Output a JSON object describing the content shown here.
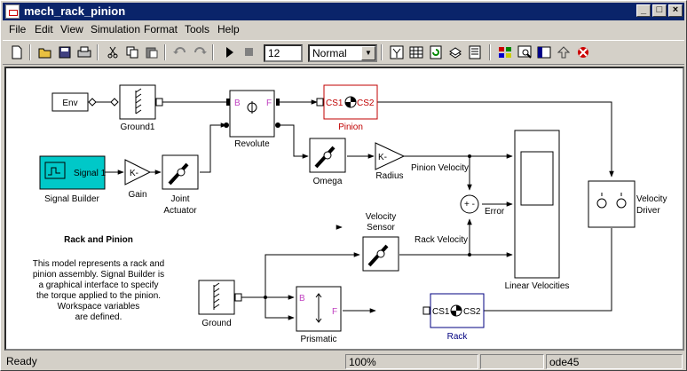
{
  "window": {
    "title": "mech_rack_pinion",
    "minimize": "_",
    "maximize": "□",
    "close": "×"
  },
  "menu": [
    "File",
    "Edit",
    "View",
    "Simulation",
    "Format",
    "Tools",
    "Help"
  ],
  "toolbar": {
    "stop_time": "12",
    "sim_mode": "Normal"
  },
  "blocks": {
    "env": "Env",
    "ground1": "Ground1",
    "revolute": "Revolute",
    "revolute_b": "B",
    "revolute_f": "F",
    "pinion": "Pinion",
    "pinion_cs1": "CS1",
    "pinion_cs2": "CS2",
    "signal_builder": "Signal Builder",
    "signal_1": "Signal 1",
    "gain": "Gain",
    "gain_k": "K-",
    "joint_actuator_1": "Joint",
    "joint_actuator_2": "Actuator",
    "omega": "Omega",
    "radius": "Radius",
    "radius_k": "K-",
    "pinion_velocity": "Pinion Velocity",
    "error": "Error",
    "sum_signs": "+ -",
    "rack_velocity": "Rack Velocity",
    "velocity_sensor_1": "Velocity",
    "velocity_sensor_2": "Sensor",
    "linear_velocities": "Linear Velocities",
    "velocity_driver_1": "Velocity",
    "velocity_driver_2": "Driver",
    "ground": "Ground",
    "prismatic": "Prismatic",
    "prismatic_b": "B",
    "prismatic_f": "F",
    "rack": "Rack",
    "rack_cs1": "CS1",
    "rack_cs2": "CS2"
  },
  "annotation": {
    "title": "Rack and Pinion",
    "lines": [
      "This model represents a rack and",
      "pinion assembly. Signal Builder is",
      "a graphical interface to specify",
      "the torque applied to the pinion.",
      "Workspace variables",
      "are defined."
    ]
  },
  "status": {
    "left": "Ready",
    "zoom": "100%",
    "blank": "",
    "solver": "ode45"
  },
  "colors": {
    "title_bar": "#0a246a",
    "signal_builder_fill": "#00c8c8",
    "pinion_accent": "#c00000",
    "port_label": "#c040c0",
    "rack_accent": "#000080"
  }
}
